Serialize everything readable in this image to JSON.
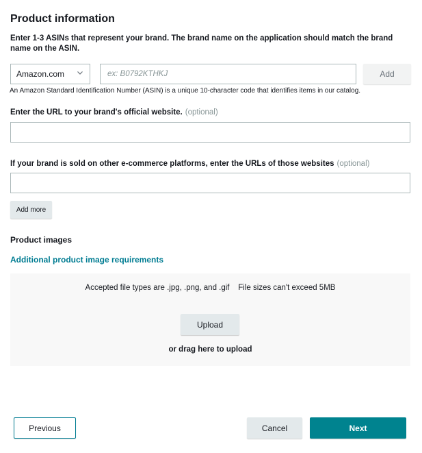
{
  "header": {
    "title": "Product information",
    "instructions": "Enter 1-3 ASINs that represent your brand. The brand name on the application should match the brand name on the ASIN."
  },
  "asin": {
    "marketplace_selected": "Amazon.com",
    "input_value": "",
    "input_placeholder": "ex: B0792KTHKJ",
    "add_label": "Add",
    "help_text": "An Amazon Standard Identification Number (ASIN) is a unique 10-character code that identifies items in our catalog."
  },
  "website": {
    "label": "Enter the URL to your brand's official website.",
    "optional_label": "(optional)",
    "value": ""
  },
  "ecommerce": {
    "label": "If your brand is sold on other e-commerce platforms, enter the URLs of those websites",
    "optional_label": "(optional)",
    "value": "",
    "add_more_label": "Add more"
  },
  "images": {
    "title": "Product images",
    "requirements_link": "Additional product image requirements",
    "accepted_text": "Accepted file types are .jpg, .png, and .gif    File sizes can't exceed 5MB",
    "upload_label": "Upload",
    "drag_text": "or drag here to upload"
  },
  "footer": {
    "previous_label": "Previous",
    "cancel_label": "Cancel",
    "next_label": "Next"
  },
  "colors": {
    "accent": "#00838f",
    "link": "#007c92",
    "dropzone_bg": "#f8f8f8"
  }
}
